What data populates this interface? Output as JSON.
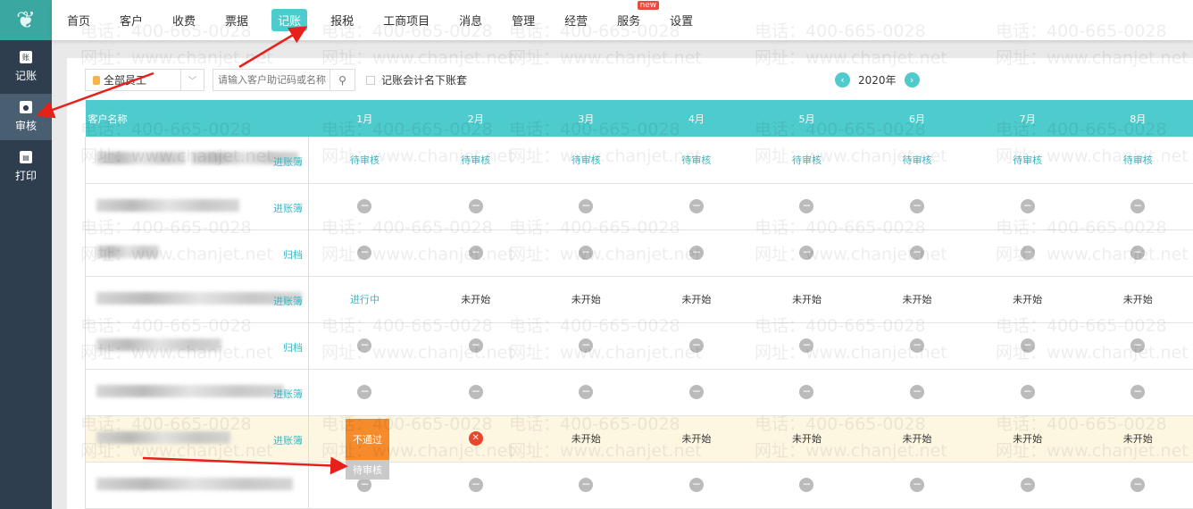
{
  "sidebar": {
    "items": [
      {
        "label": "记账",
        "icon_text": "账"
      },
      {
        "label": "审核"
      },
      {
        "label": "打印"
      }
    ]
  },
  "nav": {
    "items": [
      "首页",
      "客户",
      "收费",
      "票据",
      "记账",
      "报税",
      "工商项目",
      "消息",
      "管理",
      "经营",
      "服务",
      "设置"
    ],
    "active": "记账",
    "badge": "new"
  },
  "toolbar": {
    "employee_select": "全部员工",
    "search_placeholder": "请输入客户助记码或名称",
    "checkbox_label": "记账会计名下账套",
    "year": "2020年"
  },
  "table": {
    "name_header": "客户名称",
    "months": [
      "1月",
      "2月",
      "3月",
      "4月",
      "5月",
      "6月",
      "7月",
      "8月"
    ],
    "rows": [
      {
        "link": "进账簿",
        "cells": [
          "待审核",
          "待审核",
          "待审核",
          "待审核",
          "待审核",
          "待审核",
          "待审核",
          "待审核"
        ]
      },
      {
        "link": "进账簿",
        "cells": [
          "-",
          "-",
          "-",
          "-",
          "-",
          "-",
          "-",
          "-"
        ]
      },
      {
        "link": "归档",
        "cells": [
          "-",
          "-",
          "-",
          "-",
          "-",
          "-",
          "-",
          "-"
        ]
      },
      {
        "link": "进账簿",
        "cells": [
          "进行中",
          "未开始",
          "未开始",
          "未开始",
          "未开始",
          "未开始",
          "未开始",
          "未开始"
        ]
      },
      {
        "link": "归档",
        "cells": [
          "-",
          "-",
          "-",
          "-",
          "-",
          "-",
          "-",
          "-"
        ]
      },
      {
        "link": "进账簿",
        "cells": [
          "-",
          "-",
          "-",
          "-",
          "-",
          "-",
          "-",
          "-"
        ]
      },
      {
        "link": "进账簿",
        "highlight": true,
        "cells": [
          "不通过",
          "x",
          "未开始",
          "未开始",
          "未开始",
          "未开始",
          "未开始",
          "未开始"
        ],
        "popup": "待审核"
      },
      {
        "link": "",
        "cells": [
          "-",
          "-",
          "-",
          "-",
          "-",
          "-",
          "-",
          "-"
        ]
      }
    ]
  },
  "watermark": {
    "phone": "电话：400-665-0028",
    "site": "网址：www.chanjet.net"
  },
  "colors": {
    "accent": "#4ecbcc",
    "sidebar": "#2f3e4e",
    "reject": "#f68b2c",
    "error": "#e8472c"
  }
}
